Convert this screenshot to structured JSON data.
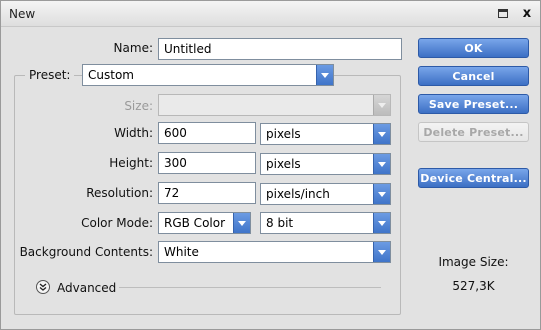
{
  "window": {
    "title": "New",
    "close_glyph": "x"
  },
  "form": {
    "name": {
      "label": "Name:",
      "value": "Untitled"
    },
    "preset": {
      "label": "Preset:",
      "value": "Custom"
    },
    "size": {
      "label": "Size:",
      "value": ""
    },
    "width": {
      "label": "Width:",
      "value": "600",
      "unit": "pixels"
    },
    "height": {
      "label": "Height:",
      "value": "300",
      "unit": "pixels"
    },
    "resolution": {
      "label": "Resolution:",
      "value": "72",
      "unit": "pixels/inch"
    },
    "color_mode": {
      "label": "Color Mode:",
      "value": "RGB Color",
      "depth": "8 bit"
    },
    "background": {
      "label": "Background Contents:",
      "value": "White"
    },
    "advanced": {
      "label": "Advanced",
      "icon": "chevron-double-down-icon"
    }
  },
  "buttons": {
    "ok": "OK",
    "cancel": "Cancel",
    "save_preset": "Save Preset...",
    "delete_preset": "Delete Preset...",
    "device_central": "Device Central..."
  },
  "image_size": {
    "label": "Image Size:",
    "value": "527,3K"
  },
  "colors": {
    "accent": "#3c6fc4",
    "background": "#e2e2e2",
    "disabled_text": "#a8a8a8"
  }
}
